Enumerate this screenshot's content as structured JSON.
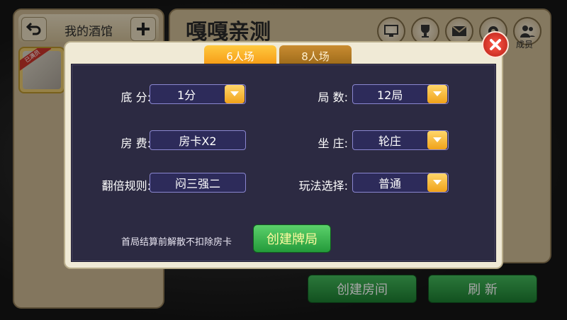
{
  "sidebar": {
    "title": "我的酒馆",
    "club_badge": "已满员"
  },
  "main": {
    "title": "嘎嘎亲测",
    "icons": [
      {
        "name": "share-icon",
        "label": "分享"
      },
      {
        "name": "trophy-icon",
        "label": "战绩"
      },
      {
        "name": "mail-icon",
        "label": "消息"
      },
      {
        "name": "gear-icon",
        "label": "设置"
      },
      {
        "name": "members-icon",
        "label": "成员"
      }
    ]
  },
  "buttons": {
    "create_room": "创建房间",
    "refresh": "刷 新"
  },
  "modal": {
    "tabs": [
      {
        "label": "6人场",
        "active": true
      },
      {
        "label": "8人场",
        "active": false
      }
    ],
    "fields": {
      "base_score": {
        "label": "底 分:",
        "value": "1分"
      },
      "rounds": {
        "label": "局 数:",
        "value": "12局"
      },
      "room_fee": {
        "label": "房 费:",
        "value": "房卡X2"
      },
      "banker": {
        "label": "坐 庄:",
        "value": "轮庄"
      },
      "double_rule": {
        "label": "翻倍规则:",
        "value": "闷三强二"
      },
      "play_mode": {
        "label": "玩法选择:",
        "value": "普通"
      }
    },
    "note": "首局结算前解散不扣除房卡",
    "create_label": "创建牌局"
  },
  "colors": {
    "accent": "#f59812",
    "panel": "#2c2a42",
    "field_border": "#8a86d0",
    "green": "#249a3a"
  }
}
